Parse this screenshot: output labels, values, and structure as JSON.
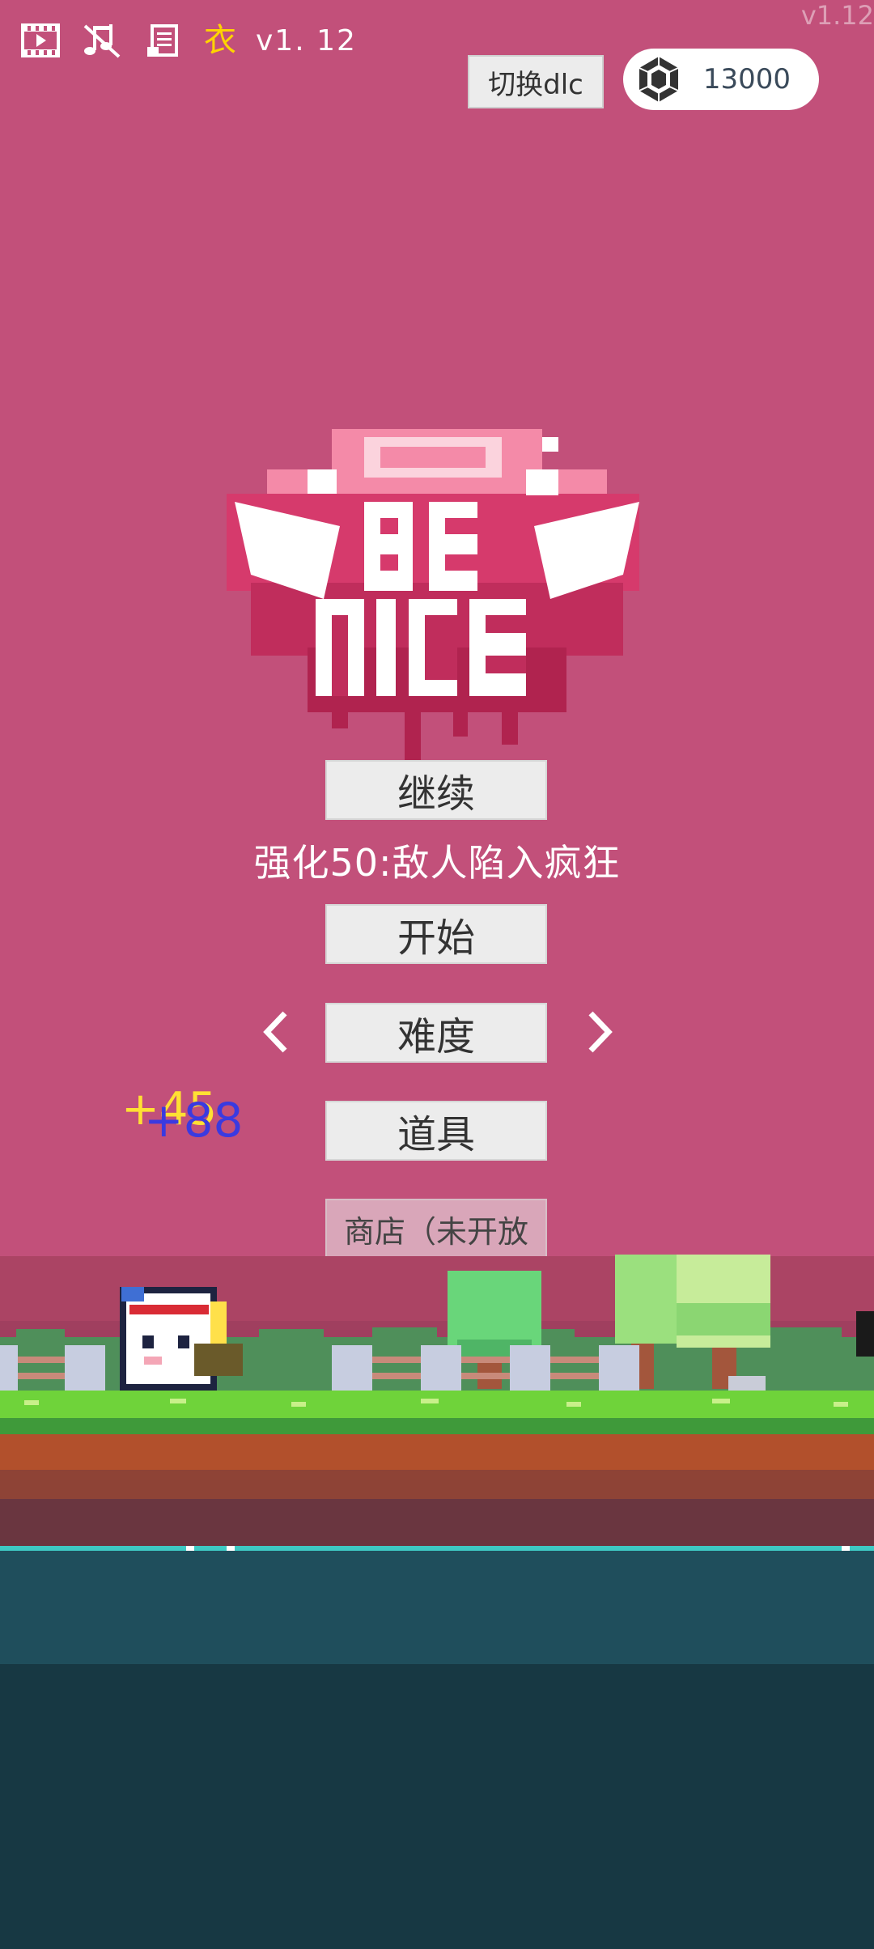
{
  "top_bar": {
    "icons": [
      "video-icon",
      "music-muted-icon",
      "notes-icon"
    ],
    "clothes_label": "衣",
    "version_label": "v1. 12",
    "version_corner": "v1.12",
    "dlc_button": "切换dlc",
    "gem_count": "13000"
  },
  "menu": {
    "continue": "继续",
    "enhance_hint": "强化50:敌人陷入疯狂",
    "start": "开始",
    "difficulty": "难度",
    "items": "道具",
    "shop": "商店（未开放"
  },
  "floating_numbers": {
    "yellow": "+45",
    "blue": "+88"
  },
  "colors": {
    "background": "#c2507a",
    "grass": "#6fd33a",
    "dirt": "#b2502c",
    "water": "#1f4e5c"
  }
}
